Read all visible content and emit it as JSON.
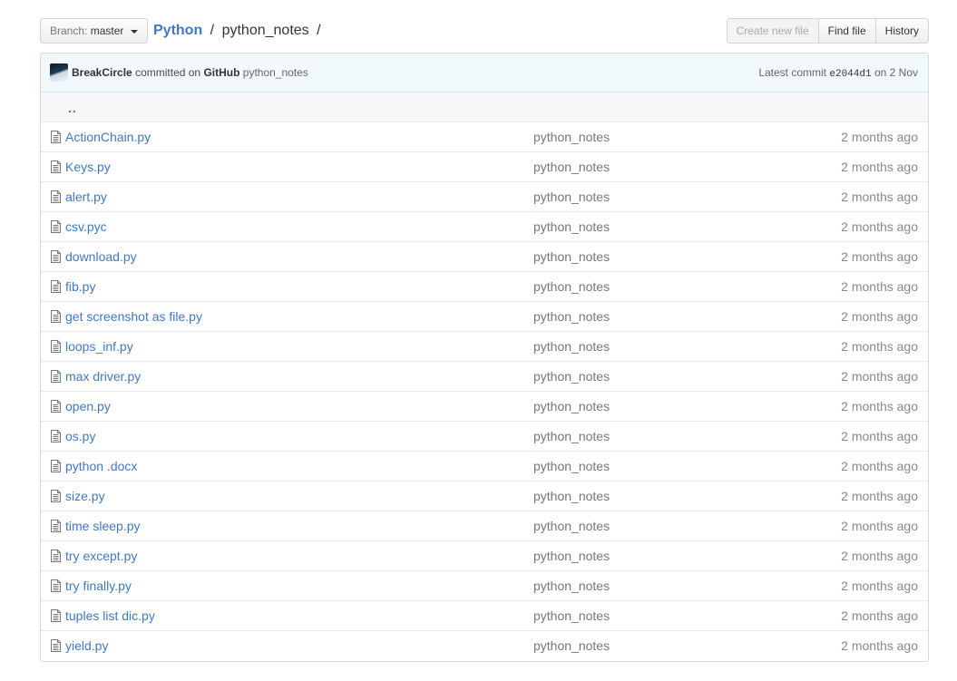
{
  "branch": {
    "prefix": "Branch:",
    "name": "master"
  },
  "breadcrumb": {
    "root": "Python",
    "separator": "/",
    "current": "python_notes",
    "trailing": "/"
  },
  "actions": {
    "create_new_file": "Create new file",
    "find_file": "Find file",
    "history": "History"
  },
  "commit": {
    "author": "BreakCircle",
    "committed_on": "committed on",
    "platform": "GitHub",
    "message": "python_notes",
    "latest_label": "Latest commit",
    "sha": "e2044d1",
    "on_label": "on",
    "date": "2 Nov"
  },
  "parent_dir": "..",
  "files": [
    {
      "name": "ActionChain.py",
      "message": "python_notes",
      "age": "2 months ago"
    },
    {
      "name": "Keys.py",
      "message": "python_notes",
      "age": "2 months ago"
    },
    {
      "name": "alert.py",
      "message": "python_notes",
      "age": "2 months ago"
    },
    {
      "name": "csv.pyc",
      "message": "python_notes",
      "age": "2 months ago"
    },
    {
      "name": "download.py",
      "message": "python_notes",
      "age": "2 months ago"
    },
    {
      "name": "fib.py",
      "message": "python_notes",
      "age": "2 months ago"
    },
    {
      "name": "get screenshot as file.py",
      "message": "python_notes",
      "age": "2 months ago"
    },
    {
      "name": "loops_inf.py",
      "message": "python_notes",
      "age": "2 months ago"
    },
    {
      "name": "max driver.py",
      "message": "python_notes",
      "age": "2 months ago"
    },
    {
      "name": "open.py",
      "message": "python_notes",
      "age": "2 months ago"
    },
    {
      "name": "os.py",
      "message": "python_notes",
      "age": "2 months ago"
    },
    {
      "name": "python .docx",
      "message": "python_notes",
      "age": "2 months ago"
    },
    {
      "name": "size.py",
      "message": "python_notes",
      "age": "2 months ago"
    },
    {
      "name": "time sleep.py",
      "message": "python_notes",
      "age": "2 months ago"
    },
    {
      "name": "try except.py",
      "message": "python_notes",
      "age": "2 months ago"
    },
    {
      "name": "try finally.py",
      "message": "python_notes",
      "age": "2 months ago"
    },
    {
      "name": "tuples list dic.py",
      "message": "python_notes",
      "age": "2 months ago"
    },
    {
      "name": "yield.py",
      "message": "python_notes",
      "age": "2 months ago"
    }
  ],
  "icons": {
    "file": "file-text-icon",
    "branch_caret": "chevron-down-icon"
  },
  "colors": {
    "link": "#4078c0",
    "commit_bar_bg": "#f2f9fc",
    "muted": "#767676"
  }
}
